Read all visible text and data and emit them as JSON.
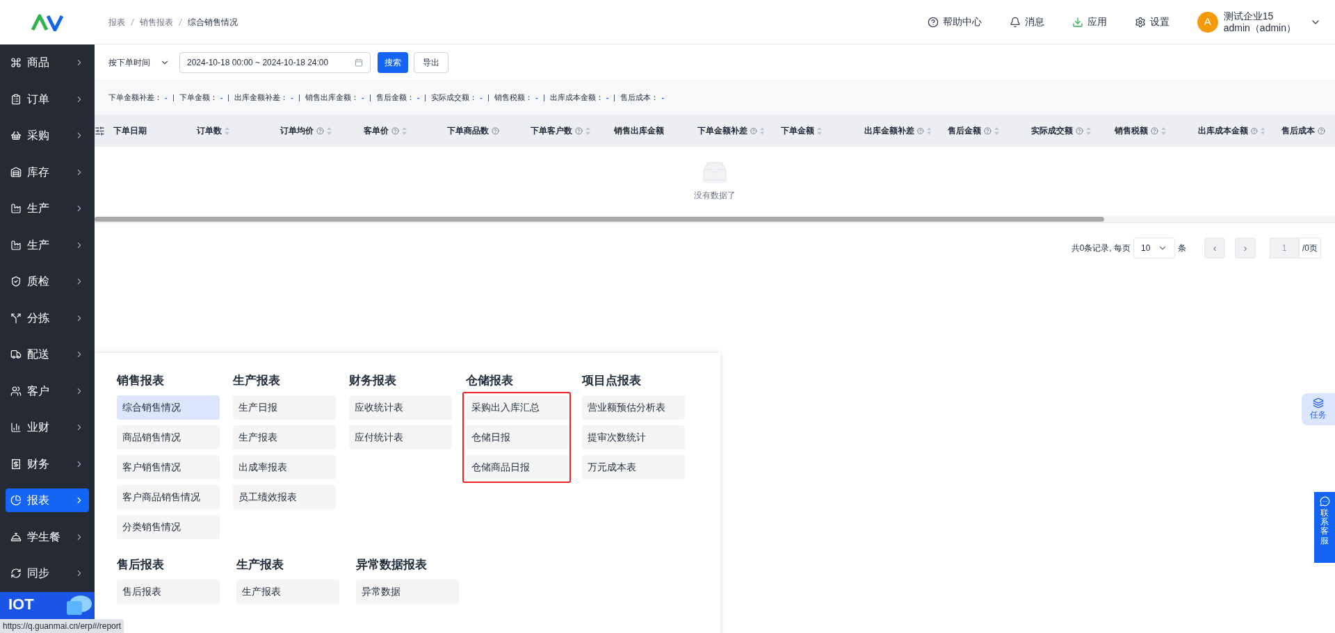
{
  "sidebar": {
    "items": [
      {
        "label": "商品",
        "selected": false
      },
      {
        "label": "订单",
        "selected": false
      },
      {
        "label": "采购",
        "selected": false
      },
      {
        "label": "库存",
        "selected": false
      },
      {
        "label": "生产",
        "selected": false
      },
      {
        "label": "生产",
        "selected": false
      },
      {
        "label": "质检",
        "selected": false
      },
      {
        "label": "分拣",
        "selected": false
      },
      {
        "label": "配送",
        "selected": false
      },
      {
        "label": "客户",
        "selected": false
      },
      {
        "label": "业财",
        "selected": false
      },
      {
        "label": "财务",
        "selected": false
      },
      {
        "label": "报表",
        "selected": true
      },
      {
        "label": "学生餐",
        "selected": false
      },
      {
        "label": "同步",
        "selected": false
      }
    ],
    "banner": "IOT"
  },
  "header": {
    "breadcrumb": [
      "报表",
      "销售报表",
      "综合销售情况"
    ],
    "actions": [
      "帮助中心",
      "消息",
      "应用",
      "设置"
    ],
    "user": {
      "avatar": "A",
      "company": "测试企业15",
      "account": "admin（admin）"
    }
  },
  "toolbar": {
    "time_type": "按下单时间",
    "date_range": "2024-10-18 00:00 ~ 2024-10-18 24:00",
    "search": "搜索",
    "export": "导出"
  },
  "stats": [
    {
      "label": "下单金额补差：",
      "value": "-"
    },
    {
      "label": "下单金额：",
      "value": "-"
    },
    {
      "label": "出库金额补差：",
      "value": "-"
    },
    {
      "label": "销售出库金额：",
      "value": "-"
    },
    {
      "label": "售后金额：",
      "value": "-"
    },
    {
      "label": "实际成交额：",
      "value": "-"
    },
    {
      "label": "销售税额：",
      "value": "-"
    },
    {
      "label": "出库成本金额：",
      "value": "-"
    },
    {
      "label": "售后成本：",
      "value": "-"
    }
  ],
  "table": {
    "columns": [
      {
        "label": "下单日期",
        "help": false,
        "sortable": false
      },
      {
        "label": "订单数",
        "help": false,
        "sortable": true
      },
      {
        "label": "订单均价",
        "help": true,
        "sortable": true
      },
      {
        "label": "客单价",
        "help": true,
        "sortable": true
      },
      {
        "label": "下单商品数",
        "help": true,
        "sortable": false
      },
      {
        "label": "下单客户数",
        "help": true,
        "sortable": true
      },
      {
        "label": "销售出库金额",
        "help": false,
        "sortable": false
      },
      {
        "label": "下单金额补差",
        "help": true,
        "sortable": true
      },
      {
        "label": "下单金额",
        "help": false,
        "sortable": true
      },
      {
        "label": "出库金额补差",
        "help": true,
        "sortable": true
      },
      {
        "label": "售后金额",
        "help": true,
        "sortable": true
      },
      {
        "label": "实际成交额",
        "help": true,
        "sortable": true
      },
      {
        "label": "销售税额",
        "help": true,
        "sortable": true
      },
      {
        "label": "出库成本金额",
        "help": true,
        "sortable": true
      },
      {
        "label": "售后成本",
        "help": true,
        "sortable": false
      }
    ],
    "empty": "没有数据了"
  },
  "pagination": {
    "total": "共0条记录, 每页",
    "page_size": "10",
    "unit": "条",
    "prev": "‹",
    "next": "›",
    "page": "1",
    "pages": "/0页"
  },
  "report_menu": {
    "rows": [
      [
        {
          "title": "销售报表",
          "outlined": false,
          "items": [
            {
              "label": "综合销售情况",
              "selected": true
            },
            {
              "label": "商品销售情况",
              "selected": false
            },
            {
              "label": "客户销售情况",
              "selected": false
            },
            {
              "label": "客户商品销售情况",
              "selected": false
            },
            {
              "label": "分类销售情况",
              "selected": false
            }
          ]
        },
        {
          "title": "生产报表",
          "outlined": false,
          "items": [
            {
              "label": "生产日报",
              "selected": false
            },
            {
              "label": "生产报表",
              "selected": false
            },
            {
              "label": "出成率报表",
              "selected": false
            },
            {
              "label": "员工绩效报表",
              "selected": false
            }
          ]
        },
        {
          "title": "财务报表",
          "outlined": false,
          "items": [
            {
              "label": "应收统计表",
              "selected": false
            },
            {
              "label": "应付统计表",
              "selected": false
            }
          ]
        },
        {
          "title": "仓储报表",
          "outlined": true,
          "items": [
            {
              "label": "采购出入库汇总",
              "selected": false
            },
            {
              "label": "仓储日报",
              "selected": false
            },
            {
              "label": "仓储商品日报",
              "selected": false
            }
          ]
        },
        {
          "title": "项目点报表",
          "outlined": false,
          "items": [
            {
              "label": "营业额预估分析表",
              "selected": false
            },
            {
              "label": "提审次数统计",
              "selected": false
            },
            {
              "label": "万元成本表",
              "selected": false
            }
          ]
        }
      ],
      [
        {
          "title": "售后报表",
          "outlined": false,
          "items": [
            {
              "label": "售后报表",
              "selected": false
            }
          ]
        },
        {
          "title": "生产报表",
          "outlined": false,
          "items": [
            {
              "label": "生产报表",
              "selected": false
            }
          ]
        },
        {
          "title": "异常数据报表",
          "outlined": false,
          "items": [
            {
              "label": "异常数据",
              "selected": false
            }
          ]
        }
      ]
    ]
  },
  "floating": {
    "task": "任务",
    "service": "联系客服"
  },
  "status_url": "https://q.guanmai.cn/erp#/report"
}
